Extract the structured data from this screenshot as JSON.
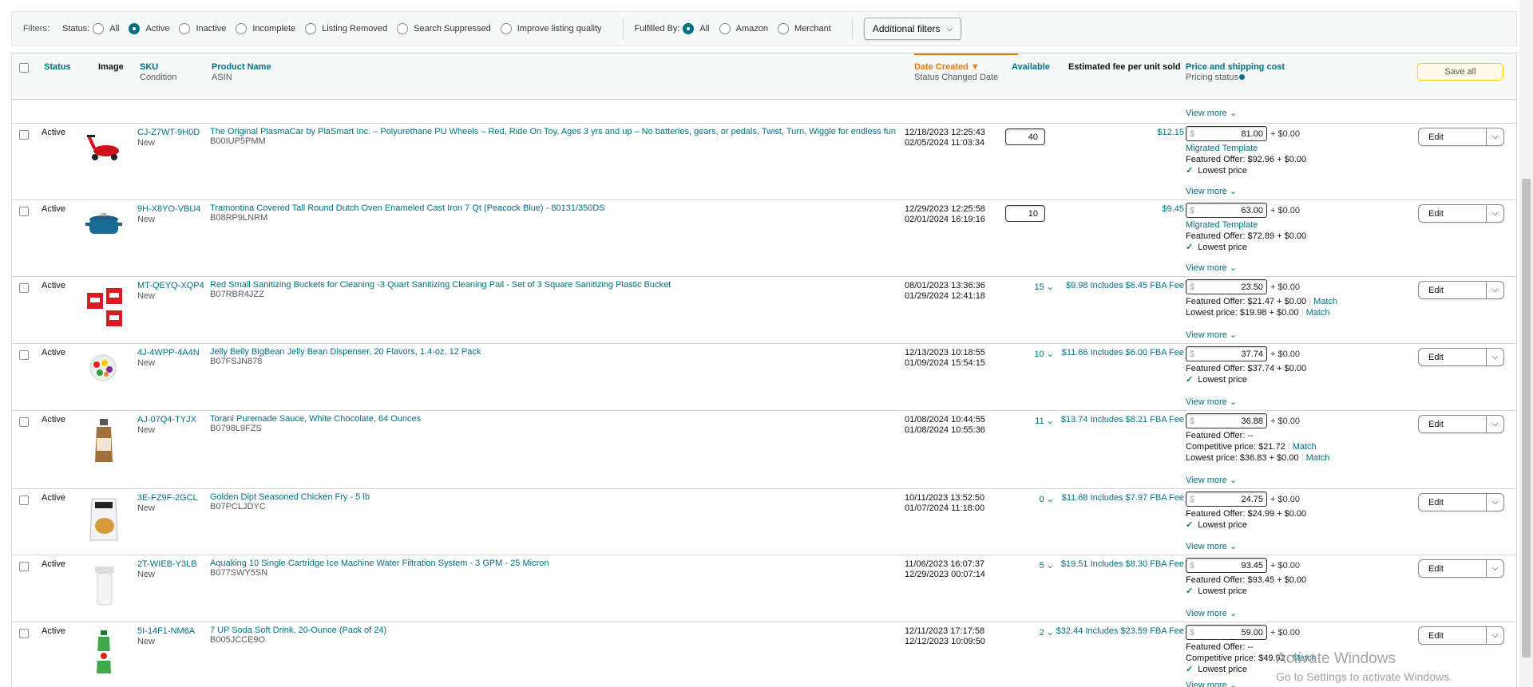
{
  "filters": {
    "label": "Filters:",
    "status_label": "Status:",
    "status_options": [
      {
        "label": "All",
        "selected": false
      },
      {
        "label": "Active",
        "selected": true
      },
      {
        "label": "Inactive",
        "selected": false
      },
      {
        "label": "Incomplete",
        "selected": false
      },
      {
        "label": "Listing Removed",
        "selected": false
      },
      {
        "label": "Search Suppressed",
        "selected": false
      },
      {
        "label": "Improve listing quality",
        "selected": false
      }
    ],
    "fulfilled_label": "Fulfilled By:",
    "fulfilled_options": [
      {
        "label": "All",
        "selected": true
      },
      {
        "label": "Amazon",
        "selected": false
      },
      {
        "label": "Merchant",
        "selected": false
      }
    ],
    "additional": "Additional filters"
  },
  "headers": {
    "status": "Status",
    "image": "Image",
    "sku": "SKU",
    "condition": "Condition",
    "product_name": "Product Name",
    "asin": "ASIN",
    "date_created": "Date Created",
    "status_changed": "Status Changed Date",
    "available": "Available",
    "fee": "Estimated fee per unit sold",
    "price": "Price and shipping cost",
    "pricing_status": "Pricing status",
    "save_all": "Save all"
  },
  "common": {
    "view_more": "View more",
    "edit": "Edit",
    "currency": "$",
    "shipping": "+ $0.00",
    "lowest_price": "Lowest price",
    "match": "Match"
  },
  "rows": [
    {
      "status": "Active",
      "sku": "CJ-Z7WT-9H0D",
      "condition": "New",
      "name": "The Original PlasmaCar by PlaSmart Inc. – Polyurethane PU Wheels – Red, Ride On Toy, Ages 3 yrs and up – No batteries, gears, or pedals, Twist, Turn, Wiggle for endless fun",
      "asin": "B00IUP5PMM",
      "created": "12/18/2023 12:25:43",
      "changed": "02/05/2024 11:03:34",
      "available": "40",
      "available_editable": true,
      "fee": "$12.15",
      "price": "81.00",
      "lines": [
        "Migrated Template",
        "Featured Offer: $92.96 + $0.00"
      ],
      "lowest": true,
      "img": "car"
    },
    {
      "status": "Active",
      "sku": "9H-X8YO-VBU4",
      "condition": "New",
      "name": "Tramontina Covered Tall Round Dutch Oven Enameled Cast Iron 7 Qt (Peacock Blue) - 80131/350DS",
      "asin": "B08RP9LNRM",
      "created": "12/29/2023 12:25:58",
      "changed": "02/01/2024 16:19:16",
      "available": "10",
      "available_editable": true,
      "fee": "$9.45",
      "price": "63.00",
      "lines": [
        "Migrated Template",
        "Featured Offer: $72.89 + $0.00"
      ],
      "lowest": true,
      "img": "pot"
    },
    {
      "status": "Active",
      "sku": "MT-QEYQ-XQP4",
      "condition": "New",
      "name": "Red Small Sanitizing Buckets for Cleaning -3 Quart Sanitizing Cleaning Pail - Set of 3 Square Sanitizing Plastic Bucket",
      "asin": "B07RBR4JZZ",
      "created": "08/01/2023 13:36:36",
      "changed": "01/29/2024 12:41:18",
      "available": "15",
      "available_editable": false,
      "fee": "$9.98 Includes $6.45 FBA Fee",
      "price": "23.50",
      "lines": [
        "Featured Offer: $21.47 + $0.00",
        "Lowest price: $19.98 + $0.00"
      ],
      "lowest": false,
      "img": "buckets"
    },
    {
      "status": "Active",
      "sku": "4J-4WPP-4A4N",
      "condition": "New",
      "name": "Jelly Belly BigBean Jelly Bean Dispenser, 20 Flavors, 1.4-oz, 12 Pack",
      "asin": "B07FSJN878",
      "created": "12/13/2023 10:18:55",
      "changed": "01/09/2024 15:54:15",
      "available": "10",
      "available_editable": false,
      "fee": "$11.66 Includes $6.00 FBA Fee",
      "price": "37.74",
      "lines": [
        "Featured Offer: $37.74 + $0.00"
      ],
      "lowest": true,
      "img": "beans"
    },
    {
      "status": "Active",
      "sku": "AJ-07Q4-TYJX",
      "condition": "New",
      "name": "Torani Puremade Sauce, White Chocolate, 64 Ounces",
      "asin": "B0798L9FZS",
      "created": "01/08/2024 10:44:55",
      "changed": "01/08/2024 10:55:36",
      "available": "11",
      "available_editable": false,
      "fee": "$13.74 Includes $8.21 FBA Fee",
      "price": "36.88",
      "lines": [
        "Featured Offer: --",
        "Competitive price: $21.72",
        "Lowest price: $36.83 + $0.00"
      ],
      "lowest": false,
      "img": "bottle"
    },
    {
      "status": "Active",
      "sku": "3E-FZ9F-2GCL",
      "condition": "New",
      "name": "Golden Dipt Seasoned Chicken Fry - 5 lb",
      "asin": "B07PCLJDYC",
      "created": "10/11/2023 13:52:50",
      "changed": "01/07/2024 11:18:00",
      "available": "0",
      "available_editable": false,
      "fee": "$11.68 Includes $7.97 FBA Fee",
      "price": "24.75",
      "lines": [
        "Featured Offer: $24.99 + $0.00"
      ],
      "lowest": true,
      "img": "bag"
    },
    {
      "status": "Active",
      "sku": "2T-WIEB-Y3LB",
      "condition": "New",
      "name": "Aquaking 10 Single Cartridge Ice Machine Water Filtration System - 3 GPM - 25 Micron",
      "asin": "B077SWY5SN",
      "created": "11/06/2023 16:07:37",
      "changed": "12/29/2023 00:07:14",
      "available": "5",
      "available_editable": false,
      "fee": "$19.51 Includes $8.30 FBA Fee",
      "price": "93.45",
      "lines": [
        "Featured Offer: $93.45 + $0.00"
      ],
      "lowest": true,
      "img": "filter"
    },
    {
      "status": "Active",
      "sku": "5I-14F1-NM6A",
      "condition": "New",
      "name": "7 UP Soda Soft Drink, 20-Ounce (Pack of 24)",
      "asin": "B005JCCE9O",
      "created": "12/11/2023 17:17:58",
      "changed": "12/12/2023 10:09:50",
      "available": "2",
      "available_editable": false,
      "fee": "$32.44 Includes $23.59 FBA Fee",
      "price": "59.00",
      "lines": [
        "Featured Offer: --",
        "Competitive price: $49.92"
      ],
      "lowest": true,
      "img": "soda"
    }
  ],
  "watermark": {
    "line1": "Activate Windows",
    "line2": "Go to Settings to activate Windows."
  },
  "colors": {
    "link": "#007185",
    "active_sort": "#e47911",
    "success": "#067d62"
  }
}
